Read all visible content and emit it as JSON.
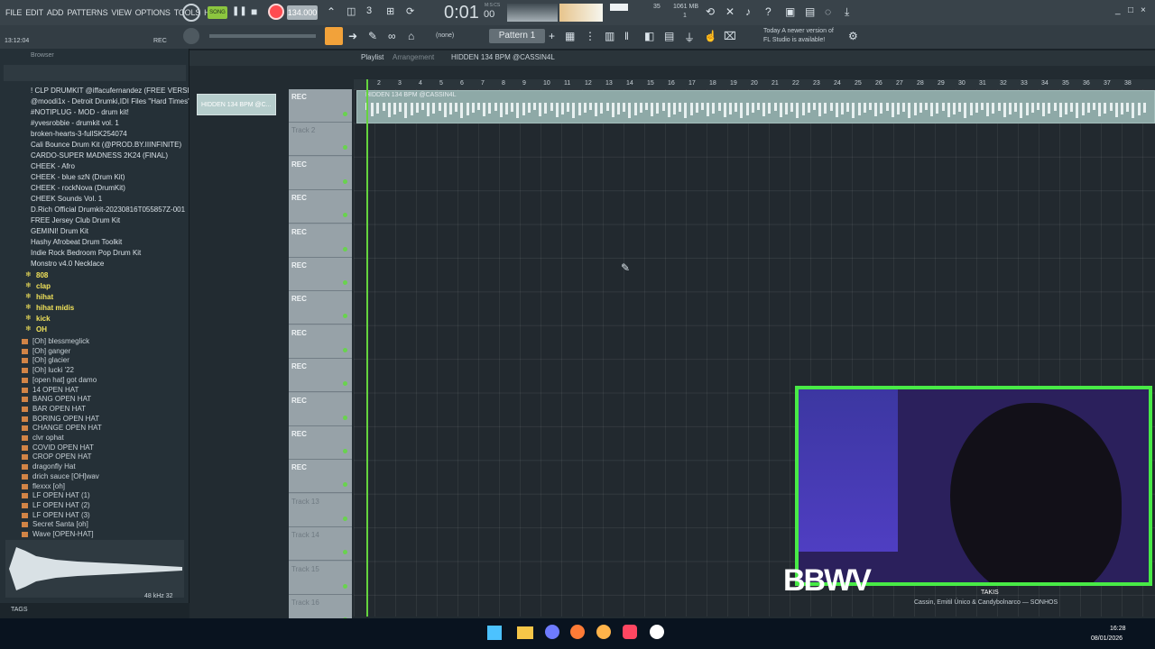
{
  "menubar": {
    "menus": [
      "FILE",
      "EDIT",
      "ADD",
      "PATTERNS",
      "VIEW",
      "OPTIONS",
      "TOOLS",
      "HELP"
    ],
    "song_label": "SONG",
    "tempo": "134.000",
    "time": "0:01",
    "time_ms": "00",
    "time_unit": "M:S:CS",
    "memory": "1061 MB",
    "cpu_value": "35",
    "polyphony": "1",
    "playing_icon_label": "0"
  },
  "toolbar2": {
    "clock": "13:12:04",
    "rec_label": "REC",
    "pattern_none": "(none)",
    "pattern": "Pattern 1",
    "news_line1": "Today  A newer version of",
    "news_line2": "FL Studio is available!"
  },
  "browser": {
    "title": "Browser",
    "folders": [
      "! CLP DRUMKIT @iffacufernandez (FREE VERSION)",
      "@moodi1x - Detroit Drumki,IDI Files \"Hard Times\"",
      "#NOTIPLUG - MOD - drum kit!",
      "#yvesrobbie - drumkit vol. 1",
      "broken-hearts-3-fullSK254074",
      "Cali Bounce Drum Kit (@PROD.BY.IIINFINITE)",
      "CARDO-SUPER MADNESS 2K24 (FINAL)",
      "CHEEK - Afro",
      "CHEEK - blue szN (Drum Kit)",
      "CHEEK - rockNova (DrumKit)",
      "CHEEK Sounds Vol. 1",
      "D.Rich Official Drumkit-20230816T055857Z-001",
      "FREE Jersey Club Drum Kit",
      "GEMINI! Drum Kit",
      "Hashy Afrobeat Drum Toolkit",
      "Indie Rock Bedroom Pop Drum Kit",
      "Monstro v4.0 Necklace"
    ],
    "subfolders": [
      "808",
      "clap",
      "hihat",
      "hihat midis",
      "kick",
      "OH"
    ],
    "files": [
      "[Oh] blessmeglick",
      "[Oh] ganger",
      "[Oh] glacier",
      "[Oh] lucki '22",
      "[open hat] got damo",
      "14 OPEN HAT",
      "BANG OPEN HAT",
      "BAR OPEN HAT",
      "BORING OPEN HAT",
      "CHANGE OPEN HAT",
      "clvr ophat",
      "COVID OPEN HAT",
      "CROP OPEN HAT",
      "dragonfly Hat",
      "drich sauce [OH]wav",
      "flexxx [oh]",
      "LF OPEN HAT (1)",
      "LF OPEN HAT (2)",
      "LF OPEN HAT (3)",
      "Secret Santa [oh]",
      "Wave [OPEN-HAT]"
    ],
    "sample_rate": "48 kHz 32",
    "tags": "TAGS"
  },
  "playlist": {
    "title": "Playlist",
    "arrangement": "Arrangement",
    "clip_name": "HIDDEN 134 BPM @CASSIN4L",
    "selected_clip": "HIDDEN 134 BPM @C...",
    "clip_label": "HIDDEN 134 BPM @CASSIN4L",
    "ruler": [
      "2",
      "3",
      "4",
      "5",
      "6",
      "7",
      "8",
      "9",
      "10",
      "11",
      "12",
      "13",
      "14",
      "15",
      "16",
      "17",
      "18",
      "19",
      "20",
      "21",
      "22",
      "23",
      "24",
      "25",
      "26",
      "27",
      "28",
      "29",
      "30",
      "31",
      "32",
      "33",
      "34",
      "35",
      "36",
      "37",
      "38"
    ],
    "tracks": [
      "REC",
      "Track 2",
      "REC",
      "REC",
      "REC",
      "REC",
      "REC",
      "REC",
      "REC",
      "REC",
      "REC",
      "REC",
      "Track 13",
      "Track 14",
      "Track 15",
      "Track 16"
    ]
  },
  "overlay": {
    "logo": "BBWV",
    "song_title": "TAKIS",
    "song_sub": "Cassin, Emitil Único & Candybolnarco — SONHOS"
  },
  "taskbar": {
    "time": "16:28",
    "date": "08/01/2026"
  }
}
